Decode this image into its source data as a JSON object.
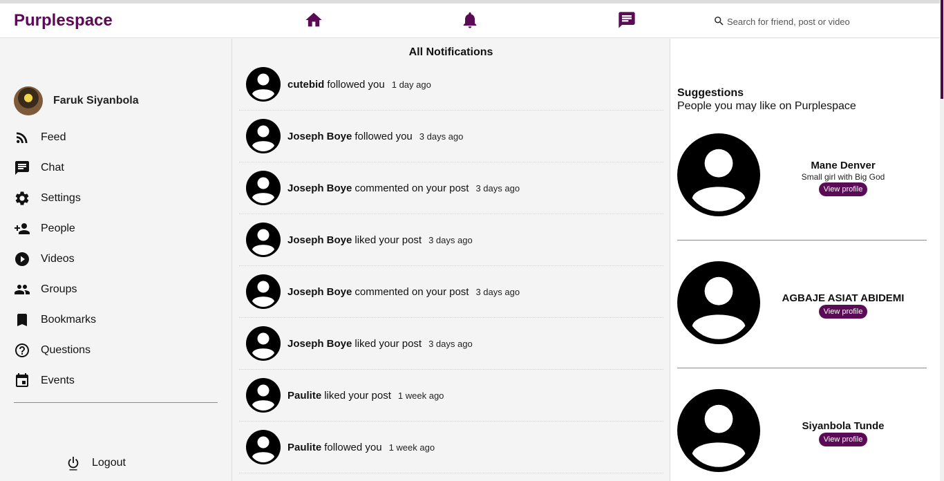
{
  "header": {
    "logo": "Purplespace",
    "search_placeholder": "Search for friend, post or video"
  },
  "sidebar": {
    "profile_name": "Faruk Siyanbola",
    "items": [
      {
        "label": "Feed",
        "icon": "rss-feed-icon"
      },
      {
        "label": "Chat",
        "icon": "chat-icon"
      },
      {
        "label": "Settings",
        "icon": "gear-icon"
      },
      {
        "label": "People",
        "icon": "person-add-icon"
      },
      {
        "label": "Videos",
        "icon": "play-circle-icon"
      },
      {
        "label": "Groups",
        "icon": "group-icon"
      },
      {
        "label": "Bookmarks",
        "icon": "bookmark-icon"
      },
      {
        "label": "Questions",
        "icon": "help-circle-icon"
      },
      {
        "label": "Events",
        "icon": "calendar-icon"
      }
    ],
    "logout_label": "Logout"
  },
  "notifications": {
    "title": "All Notifications",
    "items": [
      {
        "user": "cutebid",
        "action": "followed you",
        "time": "1 day ago"
      },
      {
        "user": "Joseph Boye",
        "action": "followed you",
        "time": "3 days ago"
      },
      {
        "user": "Joseph Boye",
        "action": "commented on your post",
        "time": "3 days ago"
      },
      {
        "user": "Joseph Boye",
        "action": "liked your post",
        "time": "3 days ago"
      },
      {
        "user": "Joseph Boye",
        "action": "commented on your post",
        "time": "3 days ago"
      },
      {
        "user": "Joseph Boye",
        "action": "liked your post",
        "time": "3 days ago"
      },
      {
        "user": "Paulite",
        "action": "liked your post",
        "time": "1 week ago"
      },
      {
        "user": "Paulite",
        "action": "followed you",
        "time": "1 week ago"
      }
    ]
  },
  "suggestions": {
    "title": "Suggestions",
    "subtitle": "People you may like on Purplespace",
    "items": [
      {
        "name": "Mane Denver",
        "bio": "Small girl with Big God",
        "button": "View profile"
      },
      {
        "name": "AGBAJE ASIAT ABIDEMI",
        "bio": "",
        "button": "View profile"
      },
      {
        "name": "Siyanbola Tunde",
        "bio": "",
        "button": "View profile"
      }
    ]
  },
  "colors": {
    "brand": "#5b0b56"
  }
}
